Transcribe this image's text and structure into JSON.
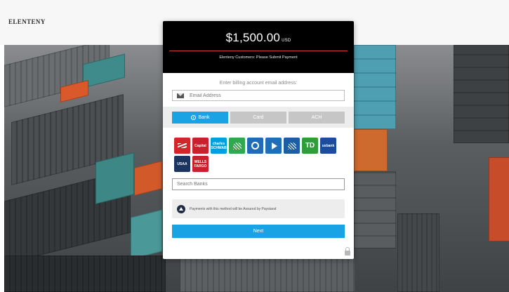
{
  "brand": {
    "logo_text": "ELENTENY"
  },
  "payment": {
    "amount": "$1,500.00",
    "currency": "USD",
    "subtitle": "Elenteny Customers: Please Submit Payment"
  },
  "email": {
    "label": "Enter billing account email address:",
    "placeholder": "Email Address",
    "icon": "envelope-icon"
  },
  "tabs": [
    {
      "label": "Bank",
      "active": true
    },
    {
      "label": "Card",
      "active": false
    },
    {
      "label": "ACH",
      "active": false
    }
  ],
  "banks": [
    {
      "label": "",
      "color": "#d4252b",
      "icon": "bank-of-america-logo"
    },
    {
      "label": "Capital",
      "color": "#c8202d",
      "icon": "capital-one-logo"
    },
    {
      "label": "charles SCHWAB",
      "color": "#00a0df",
      "icon": "charles-schwab-logo"
    },
    {
      "label": "",
      "color": "#2fa84f",
      "icon": "citizens-logo"
    },
    {
      "label": "",
      "color": "#1f6bb5",
      "icon": "globe-bank-logo"
    },
    {
      "label": "",
      "color": "#1e6fb8",
      "icon": "play-bank-logo"
    },
    {
      "label": "",
      "color": "#1a5fa3",
      "icon": "fan-bank-logo"
    },
    {
      "label": "TD",
      "color": "#2f9e3a",
      "icon": "td-bank-logo"
    },
    {
      "label": "usbank",
      "color": "#1b4d9c",
      "icon": "us-bank-logo"
    },
    {
      "label": "USAA",
      "color": "#1c3560",
      "icon": "usaa-logo"
    },
    {
      "label": "WELLS FARGO",
      "color": "#c8202d",
      "icon": "wells-fargo-logo"
    }
  ],
  "search_banks": {
    "placeholder": "Search Banks"
  },
  "assurance": {
    "text": "Payments with this method will be Assured by Paystand"
  },
  "next_label": "Next",
  "colors": {
    "accent": "#19a2e4",
    "header_bg": "#000000",
    "rule": "#cf3a3a"
  }
}
